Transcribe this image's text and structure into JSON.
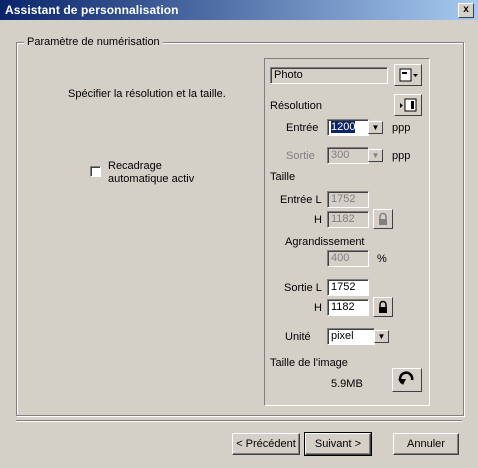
{
  "window": {
    "title": "Assistant de personnalisation",
    "close_glyph": "x"
  },
  "group": {
    "legend": "Paramètre de numérisation",
    "instruction": "Spécifier la résolution et la taille.",
    "auto_crop_line1": "Recadrage",
    "auto_crop_line2": "automatique activ",
    "auto_crop_checked": false
  },
  "panel": {
    "preset_value": "Photo",
    "resolution_label": "Résolution",
    "entree_label": "Entrée",
    "entree_value": "1200",
    "entree_unit": "ppp",
    "sortie_label": "Sortie",
    "sortie_value": "300",
    "sortie_unit": "ppp",
    "taille_label": "Taille",
    "in_l_label": "Entrée L",
    "in_l_value": "1752",
    "in_h_label": "H",
    "in_h_value": "1182",
    "agr_label": "Agrandissement",
    "agr_value": "400",
    "agr_unit": "%",
    "out_l_label": "Sortie L",
    "out_l_value": "1752",
    "out_h_label": "H",
    "out_h_value": "1182",
    "unit_label": "Unité",
    "unit_value": "pixel",
    "image_size_label": "Taille de l'image",
    "image_size_value": "5.9MB"
  },
  "buttons": {
    "back": "< Précédent",
    "next": "Suivant >",
    "cancel": "Annuler"
  },
  "icons": {
    "preset_menu": "preset-menu-icon",
    "resolution_menu": "resolution-menu-icon",
    "lock": "lock-icon",
    "reset": "undo-icon"
  }
}
